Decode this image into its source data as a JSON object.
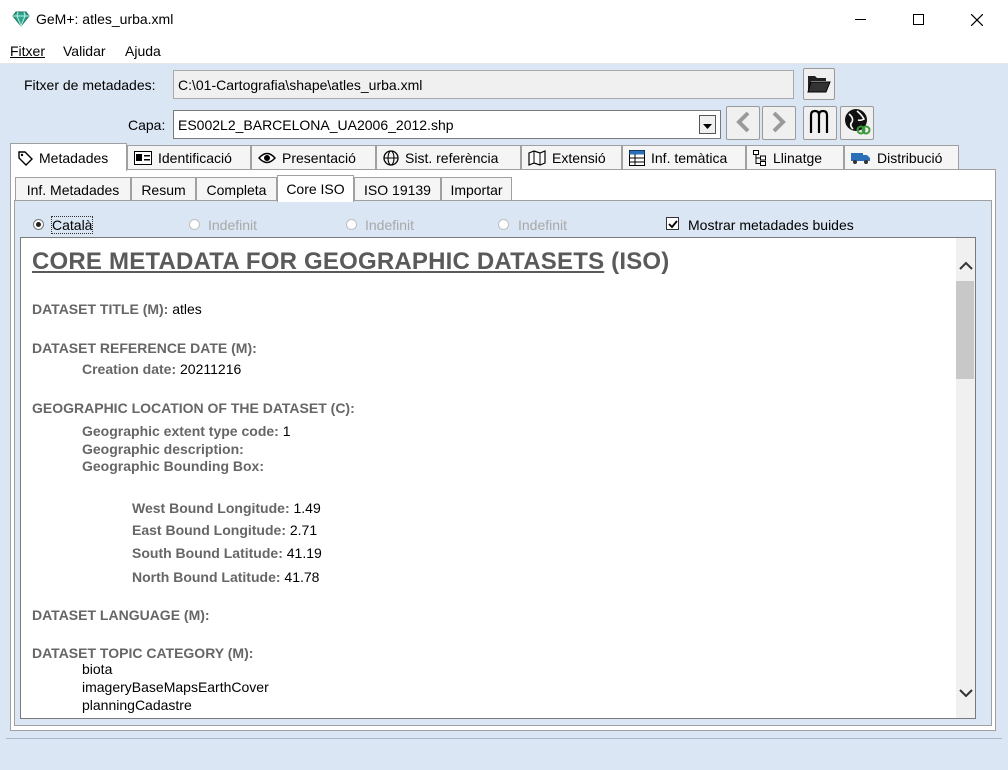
{
  "window": {
    "title": "GeM+: atles_urba.xml",
    "controls": [
      "minimize",
      "maximize",
      "close"
    ]
  },
  "menu": [
    "Fitxer",
    "Validar",
    "Ajuda"
  ],
  "file_field": {
    "label": "Fitxer de metadades:",
    "value": "C:\\01-Cartografia\\shape\\atles_urba.xml"
  },
  "layer_field": {
    "label": "Capa:",
    "value": "ES002L2_BARCELONA_UA2006_2012.shp"
  },
  "main_tabs": [
    {
      "label": "Metadades",
      "icon": "tag-icon",
      "active": true
    },
    {
      "label": "Identificació",
      "icon": "id-card-icon"
    },
    {
      "label": "Presentació",
      "icon": "eye-icon"
    },
    {
      "label": "Sist. referència",
      "icon": "globe-icon"
    },
    {
      "label": "Extensió",
      "icon": "map-icon"
    },
    {
      "label": "Inf. temàtica",
      "icon": "table-icon"
    },
    {
      "label": "Llinatge",
      "icon": "tree-icon"
    },
    {
      "label": "Distribució",
      "icon": "truck-icon"
    }
  ],
  "sub_tabs": [
    {
      "label": "Inf. Metadades"
    },
    {
      "label": "Resum"
    },
    {
      "label": "Completa"
    },
    {
      "label": "Core ISO",
      "active": true
    },
    {
      "label": "ISO 19139"
    },
    {
      "label": "Importar"
    }
  ],
  "languages": [
    {
      "label": "Català",
      "selected": true,
      "enabled": true
    },
    {
      "label": "Indefinit",
      "selected": false,
      "enabled": false
    },
    {
      "label": "Indefinit",
      "selected": false,
      "enabled": false
    },
    {
      "label": "Indefinit",
      "selected": false,
      "enabled": false
    }
  ],
  "show_empty": {
    "label": "Mostrar metadades buides",
    "checked": true
  },
  "doc": {
    "title_main": "CORE METADATA FOR GEOGRAPHIC DATASETS",
    "title_suffix": "(ISO)",
    "dataset_title_label": "DATASET TITLE (M):",
    "dataset_title_value": "atles",
    "ref_date_label": "DATASET REFERENCE DATE (M):",
    "creation_date_label": "Creation date:",
    "creation_date_value": "20211216",
    "geo_location_label": "GEOGRAPHIC LOCATION OF THE DATASET (C):",
    "extent_type_label": "Geographic extent type code:",
    "extent_type_value": "1",
    "geo_desc_label": "Geographic description:",
    "bbox_label": "Geographic Bounding Box:",
    "west_label": "West Bound Longitude:",
    "west_value": "1.49",
    "east_label": "East Bound Longitude:",
    "east_value": "2.71",
    "south_label": "South Bound Latitude:",
    "south_value": "41.19",
    "north_label": "North Bound Latitude:",
    "north_value": "41.78",
    "language_label": "DATASET LANGUAGE (M):",
    "topic_label": "DATASET TOPIC CATEGORY (M):",
    "topics": [
      "biota",
      "imageryBaseMapsEarthCover",
      "planningCadastre"
    ]
  },
  "colors": {
    "window_bg": "#dbe6f4",
    "section_text": "#666666",
    "app_icon": "#2ea58f"
  }
}
